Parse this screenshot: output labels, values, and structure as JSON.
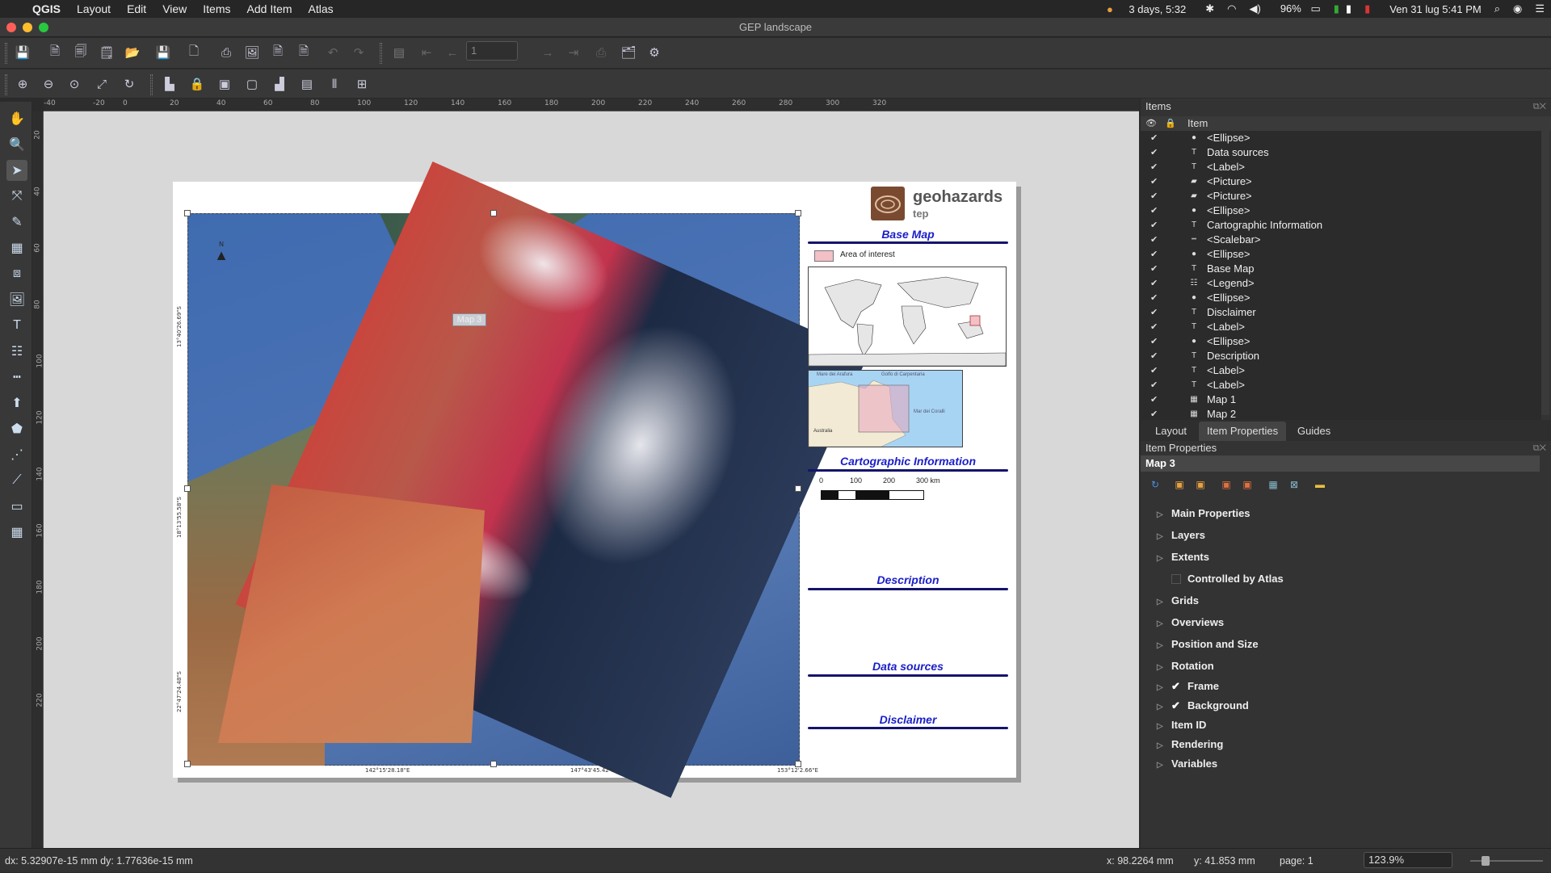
{
  "menubar": {
    "app": "QGIS",
    "menus": [
      "Layout",
      "Edit",
      "View",
      "Items",
      "Add Item",
      "Atlas"
    ],
    "status": {
      "timer": "3 days, 5:32",
      "battery": "96%",
      "datetime": "Ven 31 lug  5:41 PM"
    }
  },
  "window": {
    "title": "GEP landscape",
    "page_field": "1"
  },
  "ruler": {
    "h_ticks": [
      "-40",
      "-20",
      "0",
      "20",
      "40",
      "60",
      "80",
      "100",
      "120",
      "140",
      "160",
      "180",
      "200",
      "220",
      "240",
      "260",
      "280",
      "300",
      "320"
    ],
    "v_ticks": [
      "20",
      "40",
      "60",
      "80",
      "100",
      "120",
      "140",
      "160",
      "180",
      "200",
      "220"
    ]
  },
  "layout": {
    "map_label": "Map 3",
    "north": "N",
    "coords_left": [
      "13°40'26.69\"S",
      "18°13'55.58\"S",
      "22°47'24.48\"S"
    ],
    "coords_bottom": [
      "142°15'28.18\"E",
      "147°43'45.42\"E",
      "153°12'2.66\"E"
    ],
    "logo_text": "geohazards",
    "logo_sub": "tep",
    "legend_aoi": "Area of interest",
    "titles": {
      "base_map": "Base Map",
      "carto": "Cartographic Information",
      "description": "Description",
      "data_sources": "Data sources",
      "disclaimer": "Disclaimer"
    },
    "scalebar": [
      "0",
      "100",
      "200",
      "300 km"
    ],
    "inset_labels": [
      "Mare dei Arafura",
      "Golfo di Carpentaria",
      "Mar dei Coralli",
      "Australia"
    ]
  },
  "items_panel": {
    "title": "Items",
    "column_header": "Item",
    "rows": [
      {
        "label": "<Ellipse>",
        "icon": "ellipse"
      },
      {
        "label": "Data sources",
        "icon": "label"
      },
      {
        "label": "<Label>",
        "icon": "label"
      },
      {
        "label": "<Picture>",
        "icon": "picture"
      },
      {
        "label": "<Picture>",
        "icon": "picture"
      },
      {
        "label": "<Ellipse>",
        "icon": "ellipse"
      },
      {
        "label": "Cartographic Information",
        "icon": "label"
      },
      {
        "label": "<Scalebar>",
        "icon": "scalebar"
      },
      {
        "label": "<Ellipse>",
        "icon": "ellipse"
      },
      {
        "label": "Base Map",
        "icon": "label"
      },
      {
        "label": "<Legend>",
        "icon": "legend"
      },
      {
        "label": "<Ellipse>",
        "icon": "ellipse"
      },
      {
        "label": "Disclaimer",
        "icon": "label"
      },
      {
        "label": "<Label>",
        "icon": "label"
      },
      {
        "label": "<Ellipse>",
        "icon": "ellipse"
      },
      {
        "label": "Description",
        "icon": "label"
      },
      {
        "label": "<Label>",
        "icon": "label"
      },
      {
        "label": "<Label>",
        "icon": "label"
      },
      {
        "label": "Map 1",
        "icon": "map"
      },
      {
        "label": "Map 2",
        "icon": "map"
      }
    ]
  },
  "tabs": [
    "Layout",
    "Item Properties",
    "Guides"
  ],
  "active_tab": "Item Properties",
  "props_panel": {
    "title": "Item Properties",
    "selected_item": "Map 3",
    "sections": [
      {
        "label": "Main Properties",
        "checkbox": false
      },
      {
        "label": "Layers",
        "checkbox": false
      },
      {
        "label": "Extents",
        "checkbox": false
      },
      {
        "label": "Controlled by Atlas",
        "checkbox": "empty"
      },
      {
        "label": "Grids",
        "checkbox": false
      },
      {
        "label": "Overviews",
        "checkbox": false
      },
      {
        "label": "Position and Size",
        "checkbox": false
      },
      {
        "label": "Rotation",
        "checkbox": false
      },
      {
        "label": "Frame",
        "checkbox": "checked"
      },
      {
        "label": "Background",
        "checkbox": "checked"
      },
      {
        "label": "Item ID",
        "checkbox": false
      },
      {
        "label": "Rendering",
        "checkbox": false
      },
      {
        "label": "Variables",
        "checkbox": false
      }
    ]
  },
  "statusbar": {
    "delta": "dx: 5.32907e-15 mm dy: 1.77636e-15 mm",
    "x": "x: 98.2264 mm",
    "y": "y: 41.853 mm",
    "page": "page: 1",
    "zoom": "123.9%"
  },
  "colors": {
    "accent_blue": "#1a1ec8",
    "title_line": "#14146a",
    "aoi_fill": "#f3c0c6"
  }
}
